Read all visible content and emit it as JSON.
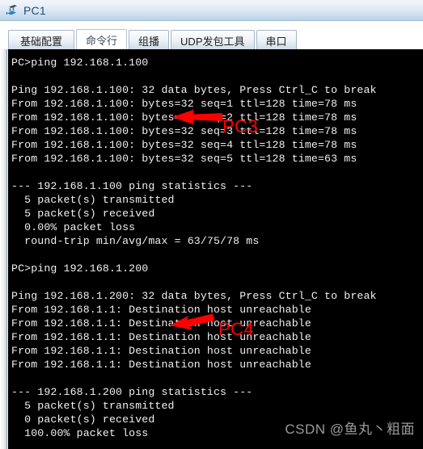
{
  "window": {
    "title": "PC1",
    "icon": "network-device-icon"
  },
  "tabs": [
    {
      "label": "基础配置",
      "active": false
    },
    {
      "label": "命令行",
      "active": true
    },
    {
      "label": "组播",
      "active": false
    },
    {
      "label": "UDP发包工具",
      "active": false
    },
    {
      "label": "串口",
      "active": false
    }
  ],
  "terminal": {
    "lines": [
      "PC>ping 192.168.1.100",
      "",
      "Ping 192.168.1.100: 32 data bytes, Press Ctrl_C to break",
      "From 192.168.1.100: bytes=32 seq=1 ttl=128 time=78 ms",
      "From 192.168.1.100: bytes=32 seq=2 ttl=128 time=78 ms",
      "From 192.168.1.100: bytes=32 seq=3 ttl=128 time=78 ms",
      "From 192.168.1.100: bytes=32 seq=4 ttl=128 time=78 ms",
      "From 192.168.1.100: bytes=32 seq=5 ttl=128 time=63 ms",
      "",
      "--- 192.168.1.100 ping statistics ---",
      "  5 packet(s) transmitted",
      "  5 packet(s) received",
      "  0.00% packet loss",
      "  round-trip min/avg/max = 63/75/78 ms",
      "",
      "PC>ping 192.168.1.200",
      "",
      "Ping 192.168.1.200: 32 data bytes, Press Ctrl_C to break",
      "From 192.168.1.1: Destination host unreachable",
      "From 192.168.1.1: Destination host unreachable",
      "From 192.168.1.1: Destination host unreachable",
      "From 192.168.1.1: Destination host unreachable",
      "From 192.168.1.1: Destination host unreachable",
      "",
      "--- 192.168.1.200 ping statistics ---",
      "  5 packet(s) transmitted",
      "  0 packet(s) received",
      "  100.00% packet loss"
    ]
  },
  "annotations": [
    {
      "label": "PC3",
      "color": "#ff0000",
      "arrow": "arrow-left-horizontal"
    },
    {
      "label": "PC4",
      "color": "#ff0000",
      "arrow": "arrow-left-diagonal"
    }
  ],
  "watermark": {
    "text": "CSDN @鱼丸丶粗面"
  }
}
